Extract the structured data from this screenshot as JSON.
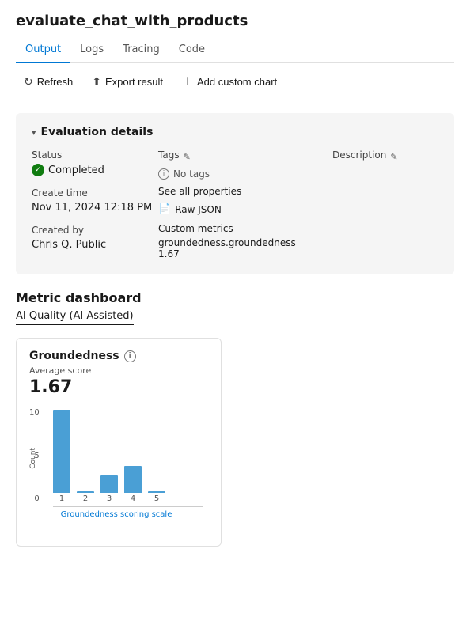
{
  "page": {
    "title": "evaluate_chat_with_products"
  },
  "tabs": [
    {
      "label": "Output",
      "active": true
    },
    {
      "label": "Logs",
      "active": false
    },
    {
      "label": "Tracing",
      "active": false
    },
    {
      "label": "Code",
      "active": false
    }
  ],
  "toolbar": {
    "refresh_label": "Refresh",
    "export_label": "Export result",
    "add_chart_label": "Add custom chart"
  },
  "eval_card": {
    "title": "Evaluation details",
    "status_label": "Status",
    "status_value": "Completed",
    "create_time_label": "Create time",
    "create_time_value": "Nov 11, 2024 12:18 PM",
    "created_by_label": "Created by",
    "created_by_value": "Chris Q. Public",
    "tags_label": "Tags",
    "no_tags_text": "No tags",
    "see_all_text": "See all properties",
    "raw_json_text": "Raw JSON",
    "custom_metrics_label": "Custom metrics",
    "metric_name": "groundedness.groundedness",
    "metric_value": "1.67",
    "description_label": "Description"
  },
  "dashboard": {
    "title": "Metric dashboard",
    "subtitle": "AI Quality (AI Assisted)",
    "groundedness": {
      "title": "Groundedness",
      "avg_label": "Average score",
      "avg_value": "1.67",
      "x_axis_label": "Groundedness scoring scale",
      "y_axis": [
        "10",
        "5",
        "0"
      ],
      "bars": [
        {
          "x": "1",
          "height_pct": 88
        },
        {
          "x": "2",
          "height_pct": 0
        },
        {
          "x": "3",
          "height_pct": 18
        },
        {
          "x": "4",
          "height_pct": 28
        },
        {
          "x": "5",
          "height_pct": 0
        }
      ]
    }
  }
}
